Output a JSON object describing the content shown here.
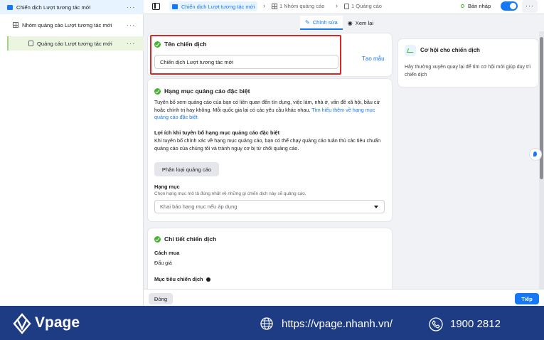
{
  "sidebar": {
    "items": [
      {
        "label": "Chiến dịch Lượt tương tác mới",
        "icon": "folder-icon",
        "more": "···"
      },
      {
        "label": "Nhóm quảng cáo Lượt tương tác mới",
        "icon": "grid-icon",
        "more": "···"
      },
      {
        "label": "Quảng cáo Lượt tương tác mới",
        "icon": "doc-icon",
        "more": "···"
      }
    ]
  },
  "topbar": {
    "breadcrumb": [
      {
        "label": "Chiến dịch Lượt tương tác mới"
      },
      {
        "label": "1 Nhóm quảng cáo"
      },
      {
        "label": "1 Quảng cáo"
      }
    ],
    "chevron": "›",
    "status": "Bản nháp",
    "toggle_on": true,
    "more": "···"
  },
  "tabs": [
    {
      "label": "Chỉnh sửa",
      "icon": "✎",
      "active": true
    },
    {
      "label": "Xem lại",
      "icon": "◉",
      "active": false
    }
  ],
  "campaign_name": {
    "title": "Tên chiến dịch",
    "value": "Chiến dịch Lượt tương tác mới",
    "template_link": "Tạo mẫu"
  },
  "special_category": {
    "title": "Hạng mục quảng cáo đặc biệt",
    "description": "Tuyên bố xem quảng cáo của bạn có liên quan đến tín dụng, việc làm, nhà ở, vấn đề xã hội, bầu cử hoặc chính trị hay không. Mỗi quốc gia lại có các yêu cầu khác nhau.",
    "learn_more": "Tìm hiểu thêm về hạng mục quảng cáo đặc biệt",
    "benefit_title": "Lợi ích khi tuyên bố hạng mục quảng cáo đặc biệt",
    "benefit_text": "Khi tuyên bố chính xác về hạng mục quảng cáo, bạn có thể chạy quảng cáo tuân thủ các tiêu chuẩn quảng cáo của chúng tôi và tránh nguy cơ bị từ chối quảng cáo.",
    "classify_button": "Phân loại quảng cáo",
    "category_label": "Hạng mục",
    "category_hint": "Chọn hạng mục mô tả đúng nhất về những gì chiến dịch này sẽ quảng cáo.",
    "category_placeholder": "Khai báo hạng mục nếu áp dụng"
  },
  "details": {
    "title": "Chi tiết chiến dịch",
    "buying_label": "Cách mua",
    "buying_value": "Đấu giá",
    "objective_label": "Mục tiêu chiến dịch",
    "info_icon": "info-icon"
  },
  "side_card": {
    "title": "Cơ hội cho chiến dịch",
    "text": "Hãy thường xuyên quay lại để tìm cơ hội mới giúp duy trì chiến dịch"
  },
  "footer": {
    "close_label": "Đóng",
    "next_label": "Tiếp"
  },
  "banner": {
    "brand": "Vpage",
    "url": "https://vpage.nhanh.vn/",
    "phone": "1900 2812"
  },
  "colors": {
    "accent": "#1877f2",
    "success": "#42b72a",
    "highlight": "#e02323",
    "banner": "#1e3c84"
  }
}
